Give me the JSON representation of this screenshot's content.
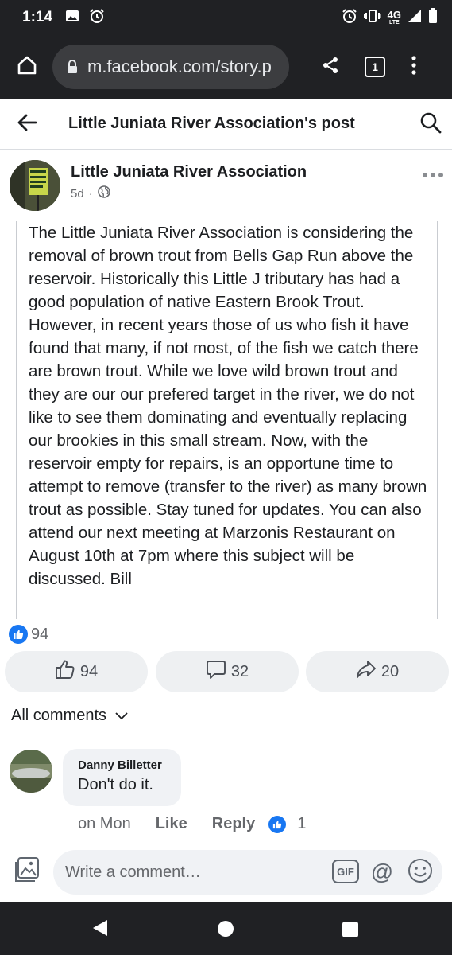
{
  "status_bar": {
    "time": "1:14",
    "network": "4G",
    "network_sub": "LTE",
    "icons": [
      "image-icon",
      "alarm-icon",
      "alarm-icon",
      "vibrate-icon",
      "signal-icon",
      "battery-icon"
    ]
  },
  "browser": {
    "url": "m.facebook.com/story.p",
    "tab_count": "1"
  },
  "header": {
    "title": "Little Juniata River Association's post"
  },
  "post": {
    "author": "Little Juniata River Association",
    "age": "5d",
    "separator": "·",
    "text": "The Little Juniata River Association is considering the removal of brown trout from Bells Gap Run above the reservoir. Historically this Little J tributary has had a good population of native Eastern Brook Trout. However, in recent years those of us who fish it have found that many, if not most, of the fish we catch there are brown trout. While we love wild brown trout and they are our our prefered target in the river,  we do not like to see them dominating and eventually replacing our brookies in this small stream. Now, with the reservoir empty for repairs, is an opportune time to attempt to remove (transfer to the river) as many brown trout as possible. Stay tuned for updates. You can also attend our next meeting at Marzonis Restaurant on August 10th at 7pm where this subject will be discussed. Bill",
    "reaction_count": "94"
  },
  "actions": {
    "like_count": "94",
    "comment_count": "32",
    "share_count": "20"
  },
  "comments_filter": "All comments",
  "comment": {
    "author": "Danny Billetter",
    "text": "Don't do it.",
    "time": "on Mon",
    "like_label": "Like",
    "reply_label": "Reply",
    "reaction_count": "1"
  },
  "compose": {
    "placeholder": "Write a comment…",
    "gif_label": "GIF",
    "mention_label": "@"
  },
  "colors": {
    "brand_blue": "#1877f2",
    "system_bar": "#202124",
    "secondary_text": "#65676b"
  }
}
